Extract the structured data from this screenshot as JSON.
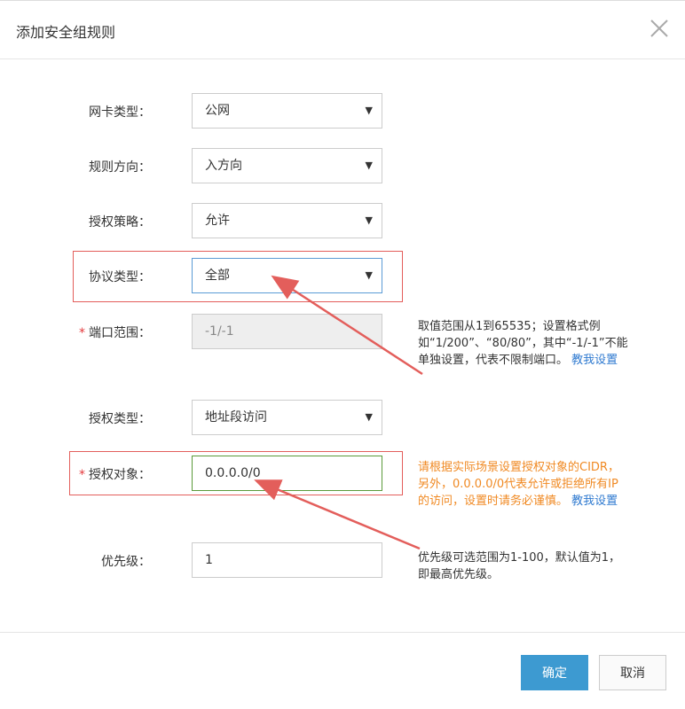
{
  "dialog": {
    "title": "添加安全组规则",
    "close_icon": "close-icon"
  },
  "fields": {
    "nic_type": {
      "label": "网卡类型：",
      "value": "公网"
    },
    "direction": {
      "label": "规则方向：",
      "value": "入方向"
    },
    "policy": {
      "label": "授权策略：",
      "value": "允许"
    },
    "protocol": {
      "label": "协议类型：",
      "value": "全部"
    },
    "port_range": {
      "label": "端口范围：",
      "value": "-1/-1",
      "required": "*"
    },
    "auth_type": {
      "label": "授权类型：",
      "value": "地址段访问"
    },
    "auth_object": {
      "label": "授权对象：",
      "value": "0.0.0.0/0",
      "required": "*"
    },
    "priority": {
      "label": "优先级：",
      "value": "1"
    }
  },
  "notes": {
    "port": {
      "line1": "取值范围从1到65535；设置格式例",
      "line2": "如“1/200”、“80/80”，其中“-1/-1”不能",
      "line3": "单独设置，代表不限制端口。",
      "link": "教我设置"
    },
    "auth": {
      "line1": "请根据实际场景设置授权对象的CIDR，",
      "line2": "另外，0.0.0.0/0代表允许或拒绝所有IP",
      "line3": "的访问，设置时请务必谨慎。",
      "link": "教我设置"
    },
    "priority": {
      "line1": "优先级可选范围为1-100，默认值为1，",
      "line2": "即最高优先级。"
    }
  },
  "footer": {
    "confirm": "确定",
    "cancel": "取消"
  },
  "colors": {
    "primary": "#3d9ad1",
    "required": "#e4393c",
    "annotation": "#e35e5b",
    "warning": "#f08a24",
    "link": "#2f7ad0"
  }
}
